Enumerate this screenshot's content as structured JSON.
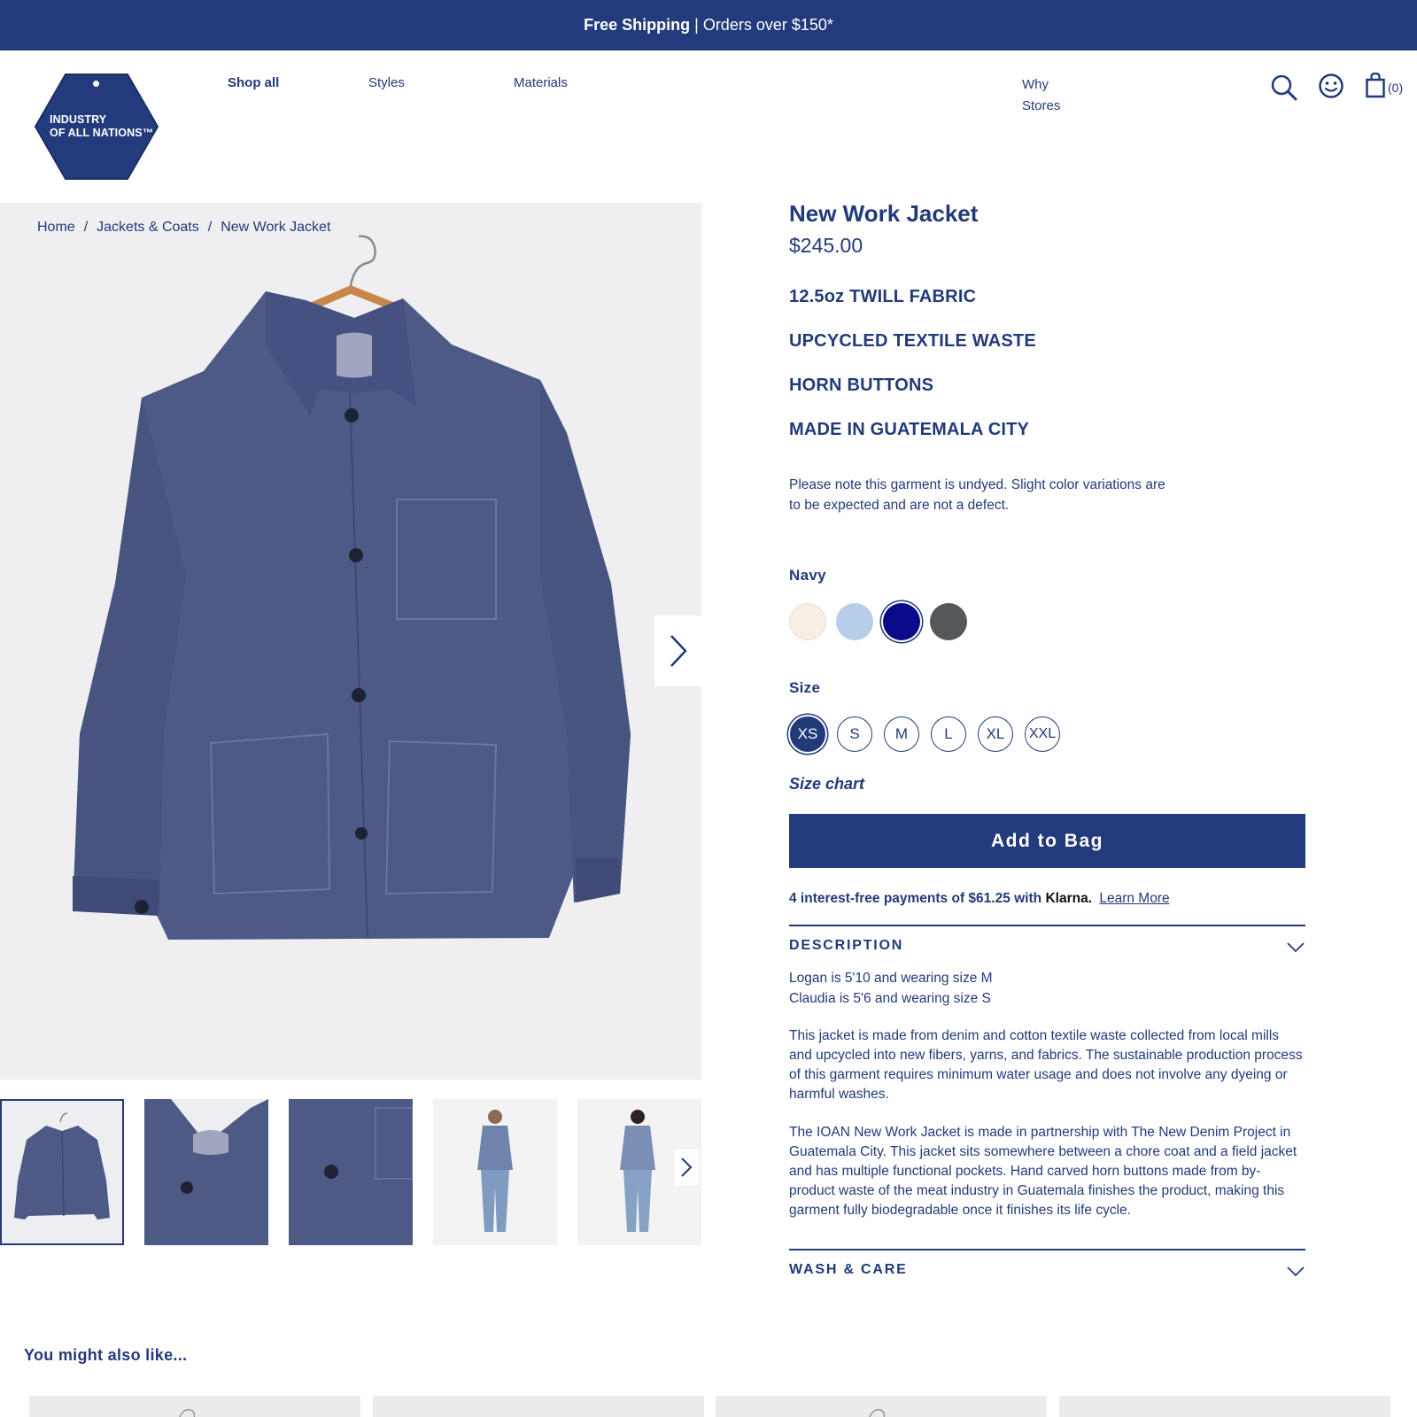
{
  "promo": {
    "strong": "Free Shipping",
    "separator": "|",
    "text": "Orders over $150*"
  },
  "brand": {
    "logo_line1": "INDUSTRY",
    "logo_line2": "OF ALL NATIONS™",
    "color": "#233b7c"
  },
  "nav": {
    "shop_all": "Shop all",
    "styles": "Styles",
    "materials": "Materials",
    "why": "Why",
    "stores": "Stores",
    "cart_count": "(0)",
    "icons": [
      "search-icon",
      "account-smiley-icon",
      "shopping-bag-icon"
    ]
  },
  "breadcrumb": {
    "home": "Home",
    "category": "Jackets & Coats",
    "current": "New Work Jacket",
    "separator": "/"
  },
  "product": {
    "title": "New Work Jacket",
    "price": "$245.00",
    "features": [
      "12.5oz TWILL FABRIC",
      "UPCYCLED TEXTILE WASTE",
      "HORN BUTTONS",
      "MADE IN GUATEMALA CITY"
    ],
    "note": "Please note this garment is undyed. Slight color variations are to be expected and are not a defect.",
    "color_label": "Navy",
    "colors": [
      {
        "name": "Ecru",
        "hex": "#f7efe6"
      },
      {
        "name": "Light Blue",
        "hex": "#b7cde8"
      },
      {
        "name": "Navy",
        "hex": "#0a0a8a",
        "selected": true
      },
      {
        "name": "Charcoal",
        "hex": "#55585a"
      }
    ],
    "size_label": "Size",
    "sizes": [
      "XS",
      "S",
      "M",
      "L",
      "XL",
      "XXL"
    ],
    "selected_size": "XS",
    "size_chart": "Size chart",
    "add_to_bag": "Add to Bag",
    "klarna": {
      "text": "4 interest-free payments of $61.25 with",
      "brand": "Klarna.",
      "link": "Learn More"
    }
  },
  "description": {
    "title": "DESCRIPTION",
    "line1": "Logan is 5'10 and wearing size M",
    "line2": "Claudia is 5'6 and wearing size S",
    "para1": "This jacket is made from denim and cotton textile waste collected from local mills and upcycled into new fibers, yarns, and fabrics. The sustainable production process of this garment requires minimum water usage and does not involve any dyeing or harmful washes.",
    "para2": "The IOAN New Work Jacket is made in partnership with The New Denim Project in Guatemala City. This jacket sits somewhere between a chore coat and a field jacket and has multiple functional pockets. Hand carved horn buttons made from by-product waste of the meat industry in Guatemala finishes the product, making this garment fully biodegradable once it finishes its life cycle."
  },
  "wash_care": {
    "title": "WASH & CARE"
  },
  "recommendations": {
    "title": "You might also like..."
  },
  "colors": {
    "accent": "#233b7c",
    "text": "#223a7a",
    "photo_bg": "#efeff1",
    "denim": "#4d5a86"
  }
}
